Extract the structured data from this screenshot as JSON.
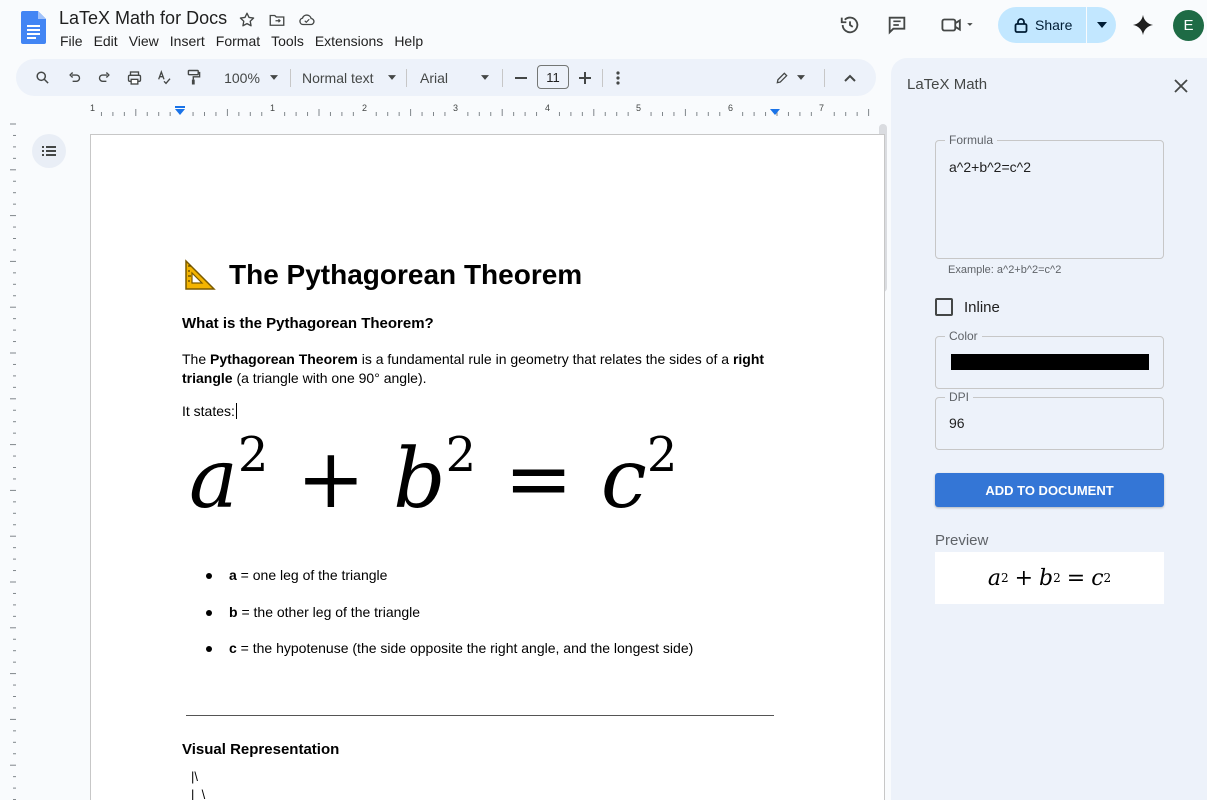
{
  "app": {
    "doc_title": "LaTeX Math for Docs",
    "menus": [
      "File",
      "Edit",
      "View",
      "Insert",
      "Format",
      "Tools",
      "Extensions",
      "Help"
    ],
    "share_label": "Share",
    "avatar_letter": "E"
  },
  "toolbar": {
    "zoom": "100%",
    "style": "Normal text",
    "font": "Arial",
    "font_size": "11"
  },
  "ruler": {
    "numbers": [
      "1",
      "1",
      "2",
      "3",
      "4",
      "5",
      "6",
      "7"
    ]
  },
  "document": {
    "heading": "The Pythagorean Theorem",
    "heading_emoji": "📐",
    "subheading": "What is the Pythagorean Theorem?",
    "para_part1": "The ",
    "para_bold1": "Pythagorean Theorem",
    "para_part2": " is a fundamental rule in geometry that relates the sides of a ",
    "para_bold2": "right triangle",
    "para_part3": " (a triangle with one 90° angle).",
    "states": "It states:",
    "equation": {
      "a": "a",
      "b": "b",
      "c": "c",
      "exp": "2",
      "plus": "+",
      "equals": "="
    },
    "bullets": [
      {
        "var": "a",
        "text": " = one leg of the triangle"
      },
      {
        "var": "b",
        "text": " = the other leg of the triangle"
      },
      {
        "var": "c",
        "text": " = the hypotenuse (the side opposite the right angle, and the longest side)"
      }
    ],
    "section2": "Visual Representation",
    "ascii_art": "|\\\n|  \\\na  |    \\  c"
  },
  "panel": {
    "title": "LaTeX Math",
    "formula_label": "Formula",
    "formula_value": "a^2+b^2=c^2",
    "example": "Example: a^2+b^2=c^2",
    "inline_label": "Inline",
    "color_label": "Color",
    "color_value": "#000000",
    "dpi_label": "DPI",
    "dpi_value": "96",
    "add_button": "ADD TO DOCUMENT",
    "preview_label": "Preview"
  },
  "colors": {
    "accent": "#3476d6",
    "share_bg": "#c2e7ff",
    "avatar": "#1e6b45",
    "docs_blue": "#4285f4"
  }
}
